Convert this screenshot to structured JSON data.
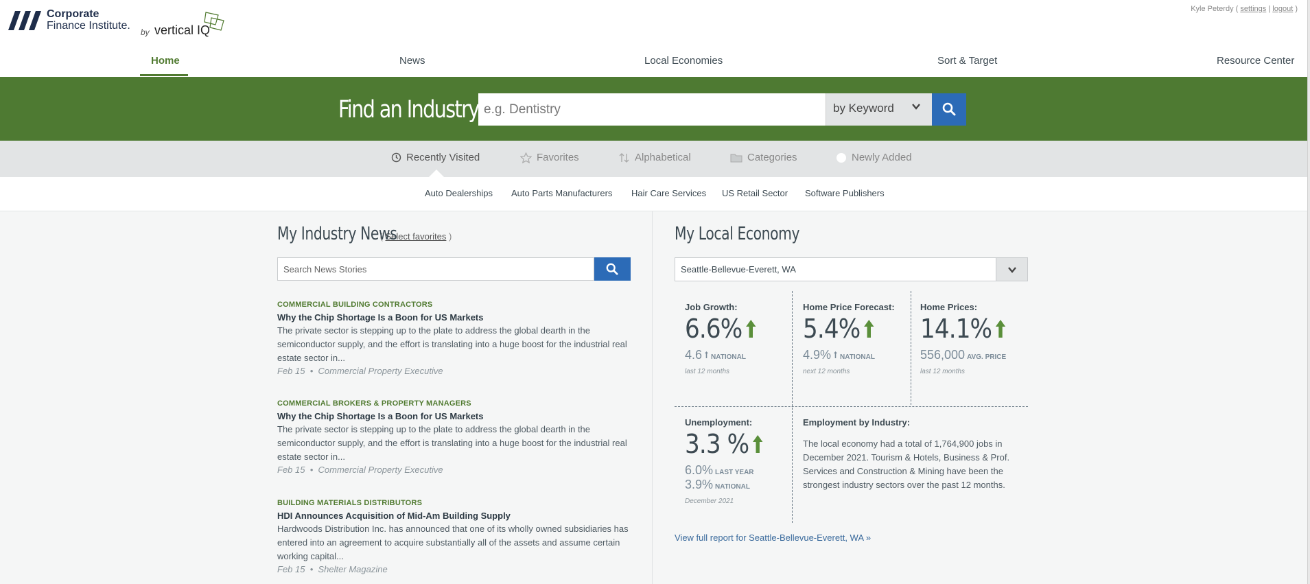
{
  "brand": {
    "name_line1": "Corporate",
    "name_line2": "Finance Institute.",
    "by": "by",
    "partner": "vertical IQ"
  },
  "user_bar": {
    "user": "Kyle Peterdy (",
    "settings": "settings",
    "sep": " | ",
    "logout": "logout",
    "close": " )"
  },
  "nav": [
    "Home",
    "News",
    "Local Economies",
    "Sort & Target",
    "Resource Center"
  ],
  "search": {
    "title": "Find an Industry",
    "placeholder": "e.g. Dentistry",
    "type_label": "by Keyword"
  },
  "tabs": [
    "Recently Visited",
    "Favorites",
    "Alphabetical",
    "Categories",
    "Newly Added"
  ],
  "recent": [
    "Auto Dealerships",
    "Auto Parts Manufacturers",
    "Hair Care Services",
    "US Retail Sector",
    "Software Publishers"
  ],
  "news": {
    "title": "My Industry News",
    "select_open": "( ",
    "select_link": "Select favorites",
    "select_close": " )",
    "search_placeholder": "Search News Stories",
    "items": [
      {
        "category": "COMMERCIAL BUILDING CONTRACTORS",
        "headline": "Why the Chip Shortage Is a Boon for US Markets",
        "summary": "The private sector is stepping up to the plate to address the global dearth in the semiconductor supply, and the effort is translating into a huge boost for the industrial real estate sector in...",
        "date": "Feb 15",
        "source": "Commercial Property Executive"
      },
      {
        "category": "COMMERCIAL BROKERS & PROPERTY MANAGERS",
        "headline": "Why the Chip Shortage Is a Boon for US Markets",
        "summary": "The private sector is stepping up to the plate to address the global dearth in the semiconductor supply, and the effort is translating into a huge boost for the industrial real estate sector in...",
        "date": "Feb 15",
        "source": "Commercial Property Executive"
      },
      {
        "category": "BUILDING MATERIALS DISTRIBUTORS",
        "headline": "HDI Announces Acquisition of Mid-Am Building Supply",
        "summary": "Hardwoods Distribution Inc. has announced that one of its wholly owned subsidiaries has entered into an agreement to acquire substantially all of the assets and assume certain working capital...",
        "date": "Feb 15",
        "source": "Shelter Magazine"
      }
    ],
    "meta_sep": "•"
  },
  "economy": {
    "title": "My Local Economy",
    "location": "Seattle-Bellevue-Everett, WA",
    "job_growth": {
      "label": "Job Growth:",
      "value": "6.6%",
      "sub_value": "4.6",
      "sub_label": "NATIONAL",
      "period": "last 12 months"
    },
    "home_price_forecast": {
      "label": "Home Price Forecast:",
      "value": "5.4%",
      "sub_value": "4.9%",
      "sub_label": "NATIONAL",
      "period": "next 12 months"
    },
    "home_prices": {
      "label": "Home Prices:",
      "value": "14.1%",
      "sub_value": "556,000",
      "sub_label": "AVG. PRICE",
      "period": "last 12 months"
    },
    "unemployment": {
      "label": "Unemployment:",
      "value": "3.3 %",
      "last_year_value": "6.0%",
      "last_year_label": "LAST YEAR",
      "national_value": "3.9%",
      "national_label": "NATIONAL",
      "period": "December 2021"
    },
    "employment": {
      "label": "Employment by Industry:",
      "text": "The local economy had a total of 1,764,900 jobs in December 2021. Tourism & Hotels, Business & Prof. Services and Construction & Mining have been the strongest industry sectors over the past 12 months."
    },
    "full_report": "View full report for Seattle-Bellevue-Everett, WA »"
  },
  "colors": {
    "brand_green": "#4e7a32",
    "accent_blue": "#2c6bb7",
    "up_arrow": "#5a8f3a"
  }
}
